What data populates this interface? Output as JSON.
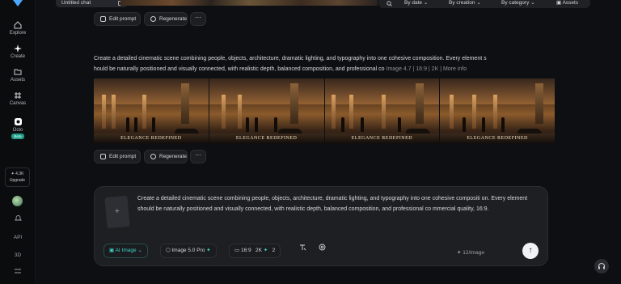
{
  "sidebar": {
    "items": [
      {
        "label": "Explore",
        "icon": "home-icon"
      },
      {
        "label": "Create",
        "icon": "sparkle-icon"
      },
      {
        "label": "Assets",
        "icon": "folder-icon"
      },
      {
        "label": "Canvas",
        "icon": "canvas-icon"
      },
      {
        "label": "Octo",
        "icon": "octo-icon",
        "badge": "Beta"
      }
    ],
    "credits": "✦ 4.3K",
    "upgrade": "Upgrade",
    "api": "API",
    "three_d": "3D"
  },
  "topbar": {
    "chat_title": "Untitled chat",
    "filters": [
      "By date",
      "By creation",
      "By category"
    ],
    "assets_label": "Assets"
  },
  "actions": {
    "edit_prompt": "Edit prompt",
    "regenerate": "Regenerate",
    "more": "···"
  },
  "message": {
    "prompt_line1": "Create a detailed cinematic scene combining people, objects, architecture, dramatic lighting, and typography into one cohesive composition. Every element s",
    "prompt_line2": "hould be naturally positioned and visually connected, with realistic depth, balanced composition, and professional co",
    "meta": "Image 4.7 | 16:9 | 2K | More info",
    "image_caption": "ELEGANCE REDEFINED"
  },
  "composer": {
    "text": "Create a detailed cinematic scene combining people, objects, architecture, dramatic lighting, and typography into one cohesive compositi on. Every element should be naturally positioned and visually connected, with realistic depth, balanced composition, and professional co mmercial quality, 16:9.",
    "mode": "AI Image",
    "model": "Image 5.0 Pro",
    "ratio": "16:9",
    "resolution": "2K",
    "count": "2",
    "credit_cost": "12/image"
  },
  "colors": {
    "accent": "#3fd3c4",
    "background": "#0e0f12"
  }
}
